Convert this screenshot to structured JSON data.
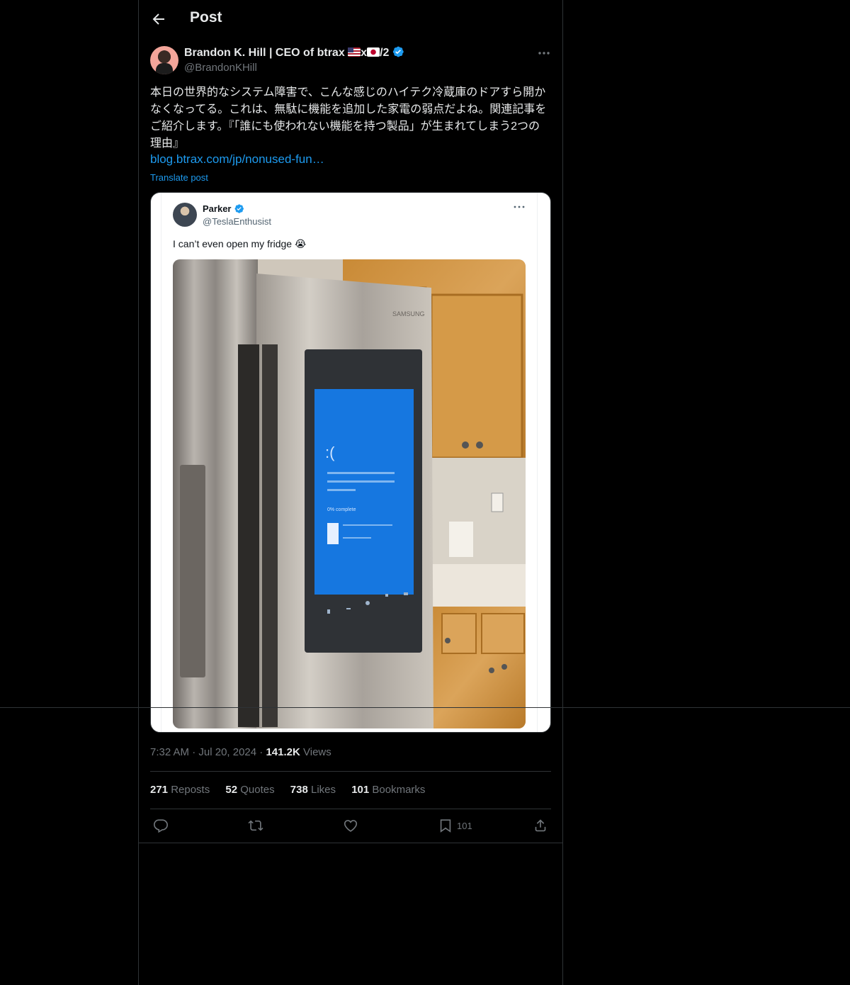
{
  "header": {
    "title": "Post"
  },
  "post": {
    "author_name": "Brandon K. Hill | CEO of btrax ",
    "author_name_mid": "x",
    "author_name_suffix": "/2",
    "handle": "@BrandonKHill",
    "text": "本日の世界的なシステム障害で、こんな感じのハイテク冷蔵庫のドアすら開かなくなってる。これは、無駄に機能を追加した家電の弱点だよね。関連記事をご紹介します。『「誰にも使われない機能を持つ製品」が生まれてしまう2つの理由』",
    "link": "blog.btrax.com/jp/nonused-fun…",
    "translate_label": "Translate post",
    "verified_color": "#1d9bf0"
  },
  "embedded": {
    "author_name": "Parker",
    "handle": "@TeslaEnthusist",
    "text": "I can’t even open my fridge 😭",
    "screen_brand": "SAMSUNG",
    "screen_face": ":(",
    "screen_pct": "0% complete"
  },
  "meta": {
    "time": "7:32 AM",
    "dot": "·",
    "date": "Jul 20, 2024",
    "views_count": "141.2K",
    "views_label": " Views"
  },
  "stats": {
    "reposts_count": "271",
    "reposts_label": " Reposts",
    "quotes_count": "52",
    "quotes_label": " Quotes",
    "likes_count": "738",
    "likes_label": " Likes",
    "bookmarks_count": "101",
    "bookmarks_label": " Bookmarks"
  },
  "actions": {
    "bookmark_count": "101"
  },
  "icons": [
    "back-arrow-icon",
    "verified-icon",
    "more-icon",
    "reply-icon",
    "repost-icon",
    "like-icon",
    "bookmark-icon",
    "share-icon"
  ]
}
